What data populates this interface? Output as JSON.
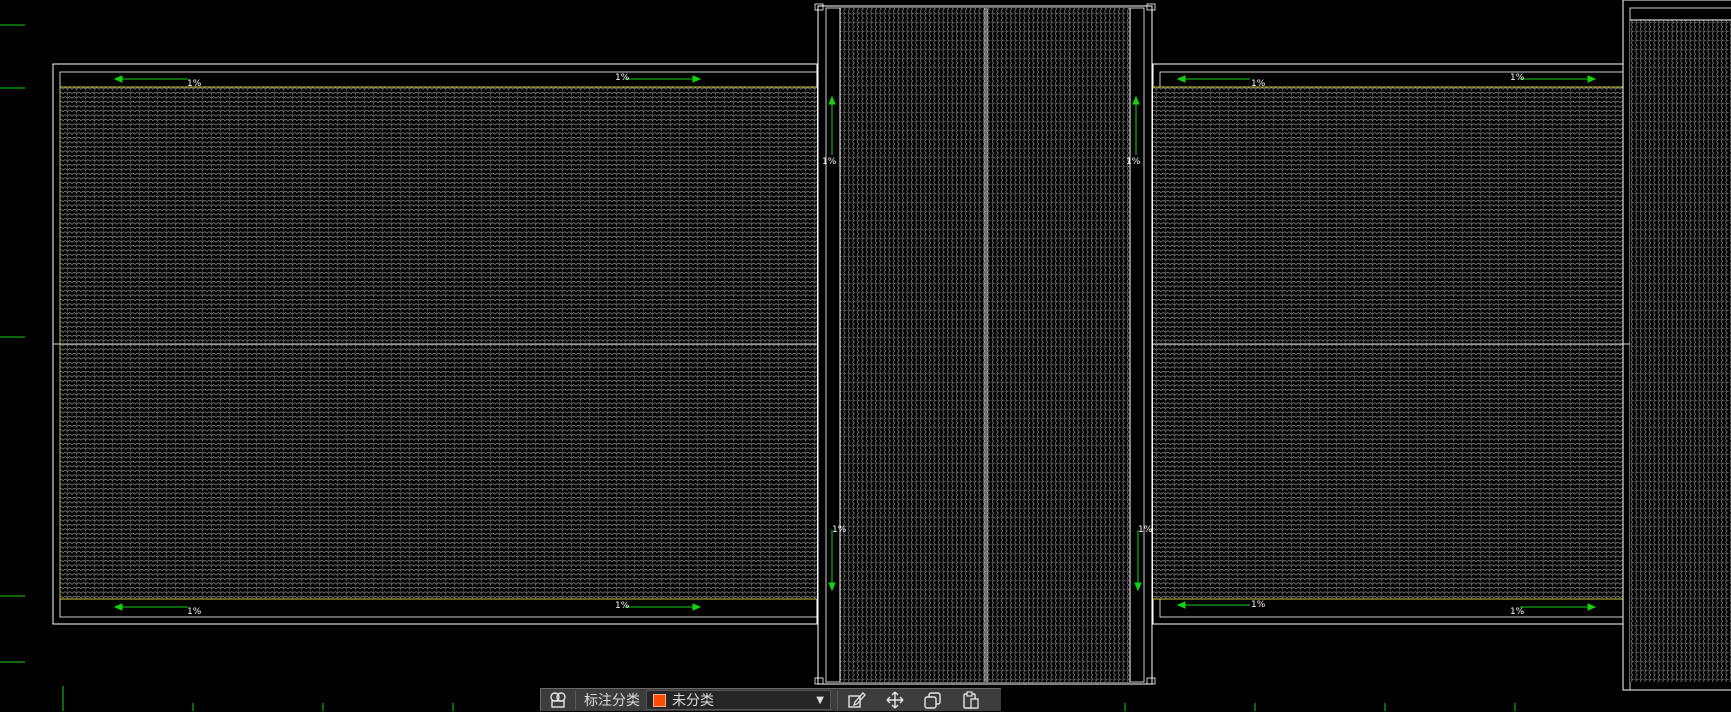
{
  "drawing": {
    "slope_label": "1%",
    "colors": {
      "background": "#000000",
      "outline": "#ffffff",
      "hatch": "#6e6e6e",
      "boundary_yellow": "#c9c23a",
      "arrow_green": "#12d212"
    }
  },
  "toolbar": {
    "category_label": "标注分类",
    "category_value": "未分类",
    "category_color": "#ff4d00",
    "icons": [
      "annotation-style-icon",
      "edit-icon",
      "move-icon",
      "copy-icon",
      "paste-icon"
    ]
  }
}
